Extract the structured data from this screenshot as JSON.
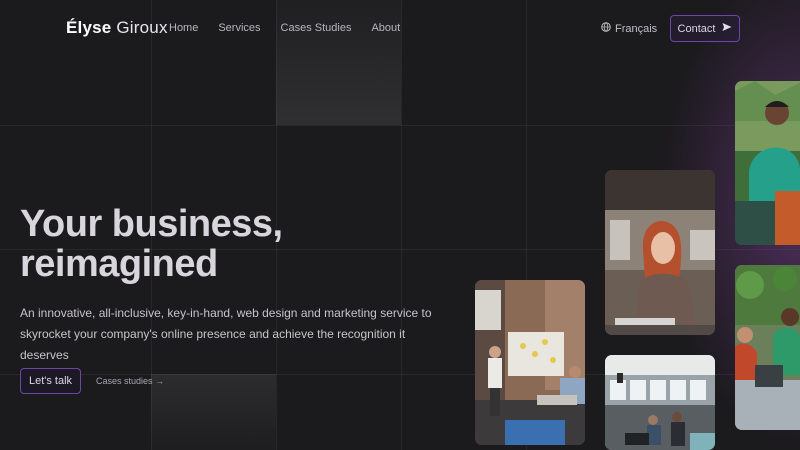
{
  "brand": {
    "first": "Élyse",
    "last": "Giroux"
  },
  "nav": {
    "links": [
      "Home",
      "Services",
      "Cases Studies",
      "About"
    ],
    "language": "Français",
    "language_icon": "globe-icon",
    "contact_label": "Contact",
    "contact_icon": "send-icon"
  },
  "hero": {
    "title_line1": "Your business,",
    "title_line2": "reimagined",
    "description_line1": "An innovative, all-inclusive, key-in-hand, web design and marketing service to",
    "description_line2": "skyrocket your company's online presence and achieve the recognition it deserves",
    "cta_primary": "Let's talk",
    "cta_secondary": "Cases studies →"
  },
  "colors": {
    "background": "#1b1a1d",
    "accent_border": "#6b46a8",
    "glow": "#8c46aa"
  },
  "images": [
    "presentation-whiteboard-photo",
    "woman-laptop-photo",
    "office-coworkers-photo",
    "smiling-man-plants-photo",
    "group-discussion-photo"
  ]
}
